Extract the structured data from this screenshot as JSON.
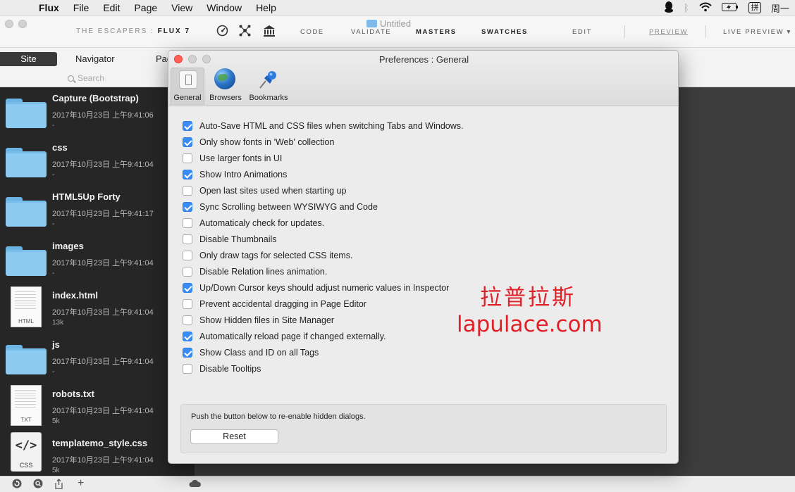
{
  "menubar": {
    "app_name": "Flux",
    "items": [
      "File",
      "Edit",
      "Page",
      "View",
      "Window",
      "Help"
    ],
    "input_method": "拼",
    "clock": "周一"
  },
  "toolbar": {
    "brand_prefix": "THE ESCAPERS :",
    "brand_name": "FLUX 7",
    "doc_title": "Untitled",
    "links": {
      "code": "CODE",
      "validate": "VALIDATE",
      "masters": "MASTERS",
      "swatches": "SWATCHES",
      "edit": "EDIT",
      "preview": "PREVIEW",
      "live_preview": "LIVE PREVIEW"
    }
  },
  "nav": {
    "site": "Site",
    "navigator": "Navigator",
    "page": "Pag"
  },
  "search": {
    "placeholder": "Search"
  },
  "files": [
    {
      "name": "Capture (Bootstrap)",
      "date": "2017年10月23日 上午9:41:06",
      "size": "-",
      "kind": "folder"
    },
    {
      "name": "css",
      "date": "2017年10月23日 上午9:41:04",
      "size": "-",
      "kind": "folder"
    },
    {
      "name": "HTML5Up Forty",
      "date": "2017年10月23日 上午9:41:17",
      "size": "-",
      "kind": "folder"
    },
    {
      "name": "images",
      "date": "2017年10月23日 上午9:41:04",
      "size": "-",
      "kind": "folder"
    },
    {
      "name": "index.html",
      "date": "2017年10月23日 上午9:41:04",
      "size": "13k",
      "kind": "html",
      "ext": "HTML"
    },
    {
      "name": "js",
      "date": "2017年10月23日 上午9:41:04",
      "size": "-",
      "kind": "folder"
    },
    {
      "name": "robots.txt",
      "date": "2017年10月23日 上午9:41:04",
      "size": "5k",
      "kind": "txt",
      "ext": "TXT"
    },
    {
      "name": "templatemo_style.css",
      "date": "2017年10月23日 上午9:41:04",
      "size": "5k",
      "kind": "css",
      "ext": "CSS",
      "glyph": "</>"
    }
  ],
  "prefs": {
    "title": "Preferences : General",
    "tabs": [
      "General",
      "Browsers",
      "Bookmarks"
    ],
    "selected_tab": "General",
    "options": [
      {
        "label": "Auto-Save HTML and CSS files when switching Tabs and Windows.",
        "checked": true
      },
      {
        "label": "Only show fonts in 'Web' collection",
        "checked": true
      },
      {
        "label": "Use larger fonts in UI",
        "checked": false
      },
      {
        "label": "Show Intro Animations",
        "checked": true
      },
      {
        "label": "Open last sites used when starting up",
        "checked": false
      },
      {
        "label": "Sync Scrolling between WYSIWYG and Code",
        "checked": true
      },
      {
        "label": "Automaticaly check for updates.",
        "checked": false
      },
      {
        "label": "Disable Thumbnails",
        "checked": false
      },
      {
        "label": "Only draw tags for selected CSS items.",
        "checked": false
      },
      {
        "label": "Disable Relation lines animation.",
        "checked": false
      },
      {
        "label": "Up/Down Cursor keys should adjust numeric values in Inspector",
        "checked": true
      },
      {
        "label": "Prevent accidental dragging in Page Editor",
        "checked": false
      },
      {
        "label": "Show Hidden files in Site Manager",
        "checked": false
      },
      {
        "label": "Automatically reload page if changed externally.",
        "checked": true
      },
      {
        "label": "Show Class and ID on all Tags",
        "checked": true
      },
      {
        "label": "Disable Tooltips",
        "checked": false
      }
    ],
    "reset_note": "Push the button below to re-enable hidden dialogs.",
    "reset_label": "Reset"
  },
  "watermark": {
    "cn": "拉普拉斯",
    "en": "lapulace.com"
  },
  "colors": {
    "accent": "#3a8cf5",
    "close": "#ff5f57",
    "inactive_button": "#d2d2d2",
    "watermark": "#e0212a",
    "sidebar": "#262626",
    "folder": "#8ccaf2"
  }
}
